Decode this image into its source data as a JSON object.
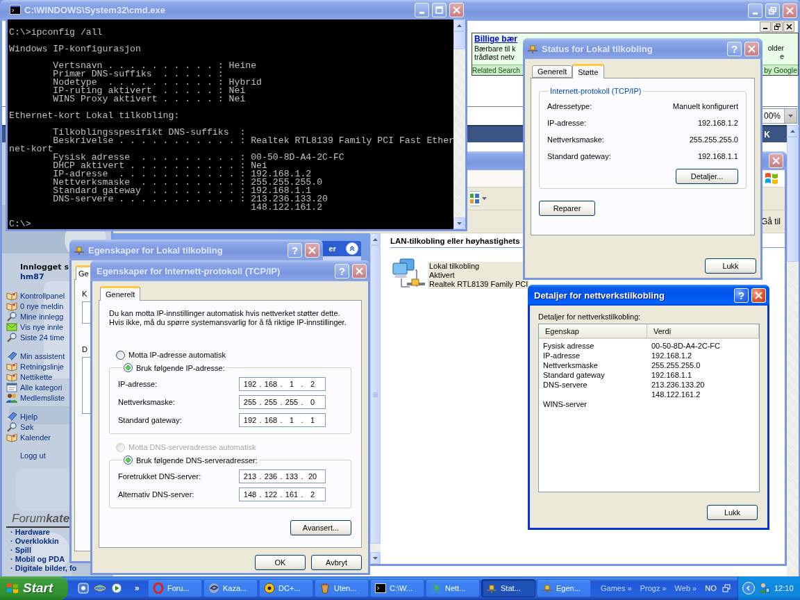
{
  "browser": {
    "ad": {
      "title": "Billige bær",
      "lines": [
        "Bærbare til k",
        "trådløst netv"
      ],
      "tail_lines": [
        "older",
        "e"
      ],
      "related": "Related Search",
      "attribution": "by Google"
    },
    "zoom": "00%",
    "nav_fragment": "K",
    "sidebar": {
      "login_label": "Innlogget s",
      "user": "hm87",
      "groups": [
        [
          {
            "kind": "book",
            "label": "Kontrollpanel"
          },
          {
            "kind": "book",
            "label": "0 nye meldin"
          },
          {
            "kind": "magnifier",
            "label": "Mine innlegg"
          },
          {
            "kind": "envelope",
            "label": "Vis nye innle"
          },
          {
            "kind": "magnifier",
            "label": "Siste 24 time"
          }
        ],
        [
          {
            "kind": "manual",
            "label": "Min assistent"
          },
          {
            "kind": "book",
            "label": "Retningslinje"
          },
          {
            "kind": "book",
            "label": "Nettikette"
          },
          {
            "kind": "list",
            "label": "Alle kategori"
          },
          {
            "kind": "people",
            "label": "Medlemsliste"
          }
        ],
        [
          {
            "kind": "manual",
            "label": "Hjelp"
          },
          {
            "kind": "magnifier",
            "label": "Søk"
          },
          {
            "kind": "book",
            "label": "Kalender"
          }
        ]
      ],
      "logout": "Logg ut",
      "forum_heading": "Forum**kate**",
      "categories": [
        "· Hardware",
        "· Overklokkin",
        "· Spill",
        "· Mobil og PDA",
        "· Digitale bilder, fo"
      ]
    }
  },
  "network_window": {
    "active": false,
    "pane_header": "er",
    "go_button": "Gå til",
    "section_title": "LAN-tilkobling eller høyhastighets",
    "connection": {
      "selected": true,
      "lines": [
        "Lokal tilkobling",
        "Aktivert",
        "Realtek RTL8139 Family PCI"
      ]
    }
  },
  "cmd": {
    "title": "C:\\WINDOWS\\System32\\cmd.exe",
    "active": false,
    "blocks": [
      [
        "C:\\>ipconfig /all"
      ],
      [
        "Windows IP-konfigurasjon"
      ],
      [
        "        Vertsnavn . . . . . . . . . . : Heine",
        "        Primær DNS-suffiks  . . . . . :",
        "        Nodetype  . . . . . . . . . . : Hybrid",
        "        IP-ruting aktivert  . . . . . : Nei",
        "        WINS Proxy aktivert . . . . . : Nei"
      ],
      [
        "Ethernet-kort Lokal tilkobling:"
      ],
      [
        "        Tilkoblingsspesifikt DNS-suffiks  :",
        "        Beskrivelse . . . . . . . . . . . : Realtek RTL8139 Family PCI Fast Ether",
        "net-kort",
        "        Fysisk adresse  . . . . . . . . . : 00-50-8D-A4-2C-FC",
        "        DHCP aktivert . . . . . . . . . . : Nei",
        "        IP-adresse  . . . . . . . . . . . : 192.168.1.2",
        "        Nettverksmaske  . . . . . . . . . : 255.255.255.0",
        "        Standard gateway  . . . . . . . . : 192.168.1.1",
        "        DNS-servere . . . . . . . . . . . : 213.236.133.20",
        "                                            148.122.161.2"
      ],
      [
        "C:\\>"
      ]
    ]
  },
  "lan_properties": {
    "title": "Egenskaper for Lokal tilkobling",
    "help": "?",
    "active": false,
    "tab": {
      "label": "Ge",
      "selected": true
    },
    "labels": [
      "K",
      "D"
    ]
  },
  "tcpip": {
    "title": "Egenskaper for Internett-protokoll (TCP/IP)",
    "help": "?",
    "active": false,
    "tabs": [
      {
        "label": "Generelt",
        "selected": true
      }
    ],
    "intro": "Du kan motta IP-innstillinger automatisk hvis nettverket støtter dette. Hvis ikke, må du spørre systemansvarlig for å få riktige IP-innstillinger.",
    "separator": ".",
    "sections": [
      {
        "auto_option": {
          "label": "Motta IP-adresse automatisk",
          "selected": false,
          "disabled": false
        },
        "manual_option": {
          "label": "Bruk følgende IP-adresse:",
          "selected": true,
          "disabled": false
        },
        "fields": [
          {
            "label": "IP-adresse:",
            "octets": [
              "192",
              "168",
              "1",
              "2"
            ]
          },
          {
            "label": "Nettverksmaske:",
            "octets": [
              "255",
              "255",
              "255",
              "0"
            ]
          },
          {
            "label": "Standard gateway:",
            "octets": [
              "192",
              "168",
              "1",
              "1"
            ]
          }
        ]
      },
      {
        "auto_option": {
          "label": "Motta DNS-serveradresse automatisk",
          "selected": false,
          "disabled": true
        },
        "manual_option": {
          "label": "Bruk følgende DNS-serveradresser:",
          "selected": true,
          "disabled": false
        },
        "fields": [
          {
            "label": "Foretrukket DNS-server:",
            "octets": [
              "213",
              "236",
              "133",
              "20"
            ]
          },
          {
            "label": "Alternativ DNS-server:",
            "octets": [
              "148",
              "122",
              "161",
              "2"
            ]
          }
        ]
      }
    ],
    "advanced_button": "Avansert...",
    "buttons": [
      "OK",
      "Avbryt"
    ]
  },
  "status": {
    "title": "Status for Lokal tilkobling",
    "help": "?",
    "active": false,
    "tabs": [
      {
        "label": "Generelt",
        "selected": false
      },
      {
        "label": "Støtte",
        "selected": true
      }
    ],
    "group_title": "Internett-protokoll (TCP/IP)",
    "rows": [
      {
        "label": "Adressetype:",
        "value": "Manuelt konfigurert"
      },
      {
        "label": "IP-adresse:",
        "value": "192.168.1.2"
      },
      {
        "label": "Nettverksmaske:",
        "value": "255.255.255.0"
      },
      {
        "label": "Standard gateway:",
        "value": "192.168.1.1"
      }
    ],
    "details_button": "Detaljer...",
    "repair_button": "Reparer",
    "close_button": "Lukk"
  },
  "details": {
    "title": "Detaljer for nettverkstilkobling",
    "help": "?",
    "active": true,
    "caption": "Detaljer for nettverkstilkobling:",
    "columns": [
      "Egenskap",
      "Verdi"
    ],
    "rows": [
      {
        "property": "Fysisk adresse",
        "value": "00-50-8D-A4-2C-FC"
      },
      {
        "property": "IP-adresse",
        "value": "192.168.1.2"
      },
      {
        "property": "Nettverksmaske",
        "value": "255.255.255.0"
      },
      {
        "property": "Standard gateway",
        "value": "192.168.1.1"
      },
      {
        "property": "DNS-servere",
        "value": "213.236.133.20"
      },
      {
        "value": "148.122.161.2"
      },
      {
        "property": "WINS-server"
      }
    ],
    "close_button": "Lukk"
  },
  "taskbar": {
    "start": "Start",
    "quick_launch_chevron": "»",
    "tasks": [
      {
        "kind": "opera",
        "label": "Foru...",
        "selected": false
      },
      {
        "kind": "kazaa",
        "label": "Kaza...",
        "selected": false
      },
      {
        "kind": "dc",
        "label": "DC+...",
        "selected": false
      },
      {
        "kind": "cup",
        "label": "Uten...",
        "selected": false
      },
      {
        "kind": "console",
        "label": "C:\\W...",
        "selected": false
      },
      {
        "kind": "globe",
        "label": "Nett...",
        "selected": false
      },
      {
        "kind": "network",
        "label": "Stat...",
        "selected": true
      },
      {
        "kind": "network",
        "label": "Egen...",
        "selected": false
      }
    ],
    "toolbars": [
      {
        "label": "Games",
        "chevron": "»"
      },
      {
        "label": "Progz",
        "chevron": "»"
      },
      {
        "label": "Web",
        "chevron": "»"
      }
    ],
    "language": "NO",
    "clock": "12:10"
  }
}
